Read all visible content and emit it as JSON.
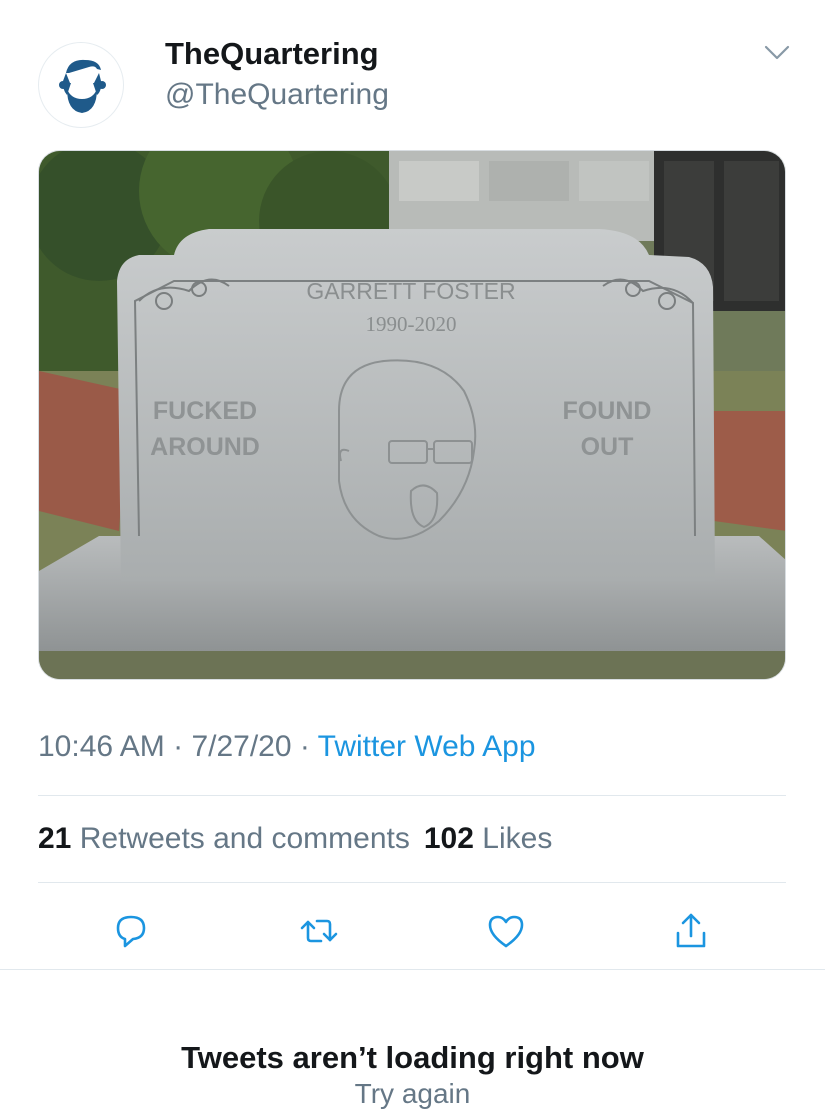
{
  "tweet": {
    "display_name": "TheQuartering",
    "handle": "@TheQuartering",
    "avatar_icon": "bearded-man-icon",
    "menu_icon": "chevron-down-icon",
    "image": {
      "headstone_name": "GARRETT FOSTER",
      "headstone_years": "1990-2020",
      "left_text_line1": "FUCKED",
      "left_text_line2": "AROUND",
      "right_text_line1": "FOUND",
      "right_text_line2": "OUT"
    },
    "time": "10:46 AM",
    "separator1": " · ",
    "date": "7/27/20",
    "separator2": " · ",
    "source": "Twitter Web App"
  },
  "stats": {
    "retweets_count": "21",
    "retweets_label": "Retweets and comments",
    "likes_count": "102",
    "likes_label": "Likes"
  },
  "actions": [
    {
      "name": "reply",
      "icon": "reply-icon"
    },
    {
      "name": "retweet",
      "icon": "retweet-icon"
    },
    {
      "name": "like",
      "icon": "heart-icon"
    },
    {
      "name": "share",
      "icon": "share-icon"
    }
  ],
  "footer": {
    "error_title": "Tweets aren’t loading right now",
    "retry_label": "Try again"
  },
  "colors": {
    "accent": "#1b95e0",
    "secondary_text": "#657786",
    "primary_text": "#14171a",
    "avatar_blue": "#1f5a8a"
  }
}
